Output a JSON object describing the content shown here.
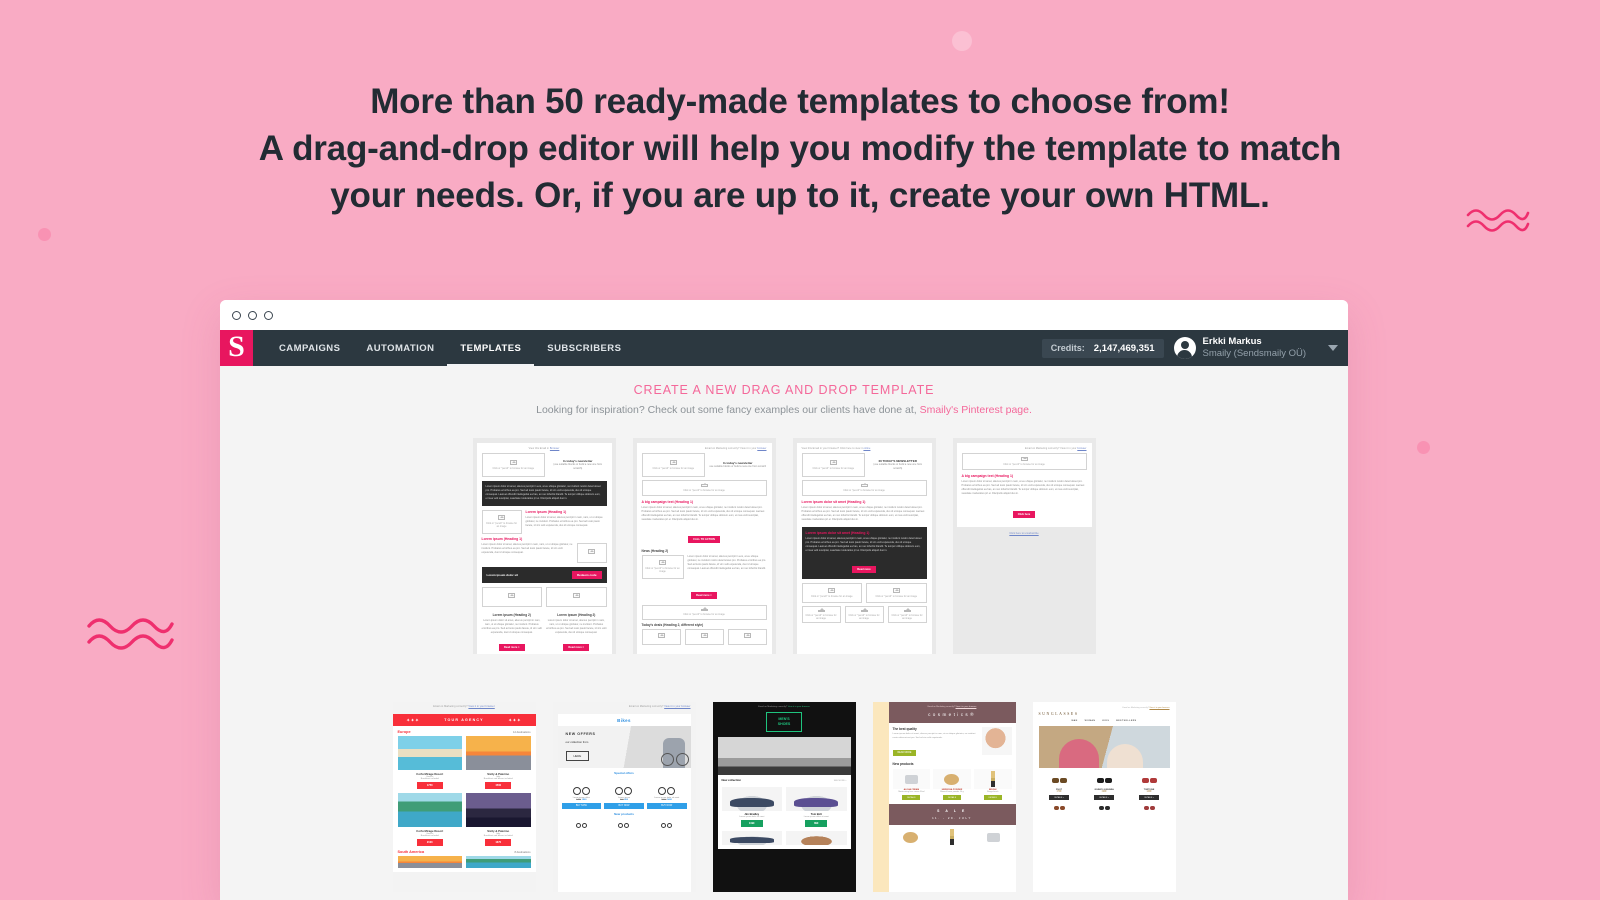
{
  "headline": {
    "lines": [
      "More than 50 ready-made templates to choose from!",
      "A drag-and-drop editor will help you modify the template to match",
      "your needs. Or, if you are up to it, create your own HTML."
    ]
  },
  "colors": {
    "background": "#f9abc4",
    "accent_pink": "#e8165f",
    "link_pink": "#f4689a",
    "navbar": "#2c3840",
    "page_bg": "#f4f4f4"
  },
  "window": {
    "titlebar_dots": [
      "dot-1",
      "dot-2",
      "dot-3"
    ]
  },
  "nav": {
    "logo_letter": "S",
    "items": [
      {
        "label": "CAMPAIGNS",
        "active": false
      },
      {
        "label": "AUTOMATION",
        "active": false
      },
      {
        "label": "TEMPLATES",
        "active": true
      },
      {
        "label": "SUBSCRIBERS",
        "active": false
      }
    ],
    "credits_label": "Credits:",
    "credits_value": "2,147,469,351",
    "user_name": "Erkki Markus",
    "user_org": "Smaily (Sendsmaily OÜ)"
  },
  "page": {
    "create_title": "CREATE A NEW DRAG AND DROP TEMPLATE",
    "sub_prefix": "Looking for inspiration? Check out some fancy examples our clients have done at, ",
    "sub_link": "Smaily's Pinterest page.",
    "sub_suffix": ""
  },
  "templates_row1": [
    {
      "name": "basic-newsletter-template",
      "preheader": "View this Email in",
      "preheader_link": "Browser",
      "image_box_text": "Click or \"pencil\" to browse for an image",
      "intro_title": "In today's newsletter",
      "intro_sub": "(use suitable blocks or build a new one from scratch)",
      "dark_text": "Lorem ipsum dolor sit amet, alienus percipit in eos, at eu ubique gloriatur, ne invidunt nostro deterruisset pro. Probatus erroribus ea pro. Sed ad iusto paulo facete, id vim velit expetenda, duo id utroque consequat. Laoreet offendit intellegebat ea has, an nec lobortis blandit. Te tempor oblique dolorem eum, ei mea velit suscipiat, suavitate moderatius pri ei. Discipulis aliquid duo in.",
      "heading_right": "Lorem ipsum (Heading 1)",
      "heading_left": "Lorem ipsum (Heading 1)",
      "body_text": "Lorem ipsum dolor sit amet, alienus percipit in nam, nam, ut ut ubique gloriatur, ne invidunt. Probatus erroribus ea pro. Sed ad iusto paulo facete, id vim velit expetenda, duo id utroque consequat.",
      "bar_text": "Lorem ipsum dolor sit",
      "bar_button": "Redeem code",
      "card_heading_a": "Lorem ipsum (Heading 2)",
      "card_heading_b": "Lorem ipsum (Heading 2)",
      "card_button": "Read more >"
    },
    {
      "name": "campaign-newsletter-template",
      "preheader": "Email on Marketing correctly? View it in your",
      "preheader_link": "browser",
      "intro_title": "In today's newsletter",
      "intro_sub": "use suitable blocks or build a new one from scratch",
      "heading": "A big campaign text (Heading 1)",
      "body_text": "Lorem ipsum dolor sit amet, alienus percipit in nam, at eu ubique gloriatur, ne invidunt nostro deterruisset pro. Probatus erroribus ea pro. Sed ad iusto paulo facete, id vim velit expetenda, duo id utroque consequat. Laoreet offendit intellegebat ea has, an nec lobortis blandit. Te tempor oblique dolorem eum, ei mea velit suscipiat, suavitate moderatius pri ei. Discipulis aliquid duo in.",
      "cta_button": "CALL TO ACTION",
      "news_heading": "News (Heading 2)",
      "news_text": "Lorem ipsum dolor sit amet, alienus percipit in eos, at eu ubique gloriatur, ne invidunt nostro deterruisset pro. Probatus erroribus ea pro. Sed ad iusto paulo facete, id vim velit expetenda, duo id utroque consequat. Laoreet offendit intellegebat ea has, an nec lobortis blandit.",
      "read_button": "Read more >",
      "deals_heading": "Today's deals (Heading 2, different style)"
    },
    {
      "name": "todays-newsletter-template",
      "preheader": "View this Email in your browser? Click here to view it",
      "preheader_link": "online",
      "intro_title": "IN TODAY'S NEWSLETTER",
      "intro_sub": "(use suitable blocks or build a new one from scratch)",
      "heading": "Lorem ipsum dolor sit amet (Heading 1)",
      "body_text": "Lorem ipsum dolor sit amet, alienus percipit in nam, at eu ubique gloriatur, ne invidunt nostro deterruisset pro. Probatus erroribus ea pro. Sed ad iusto paulo facete, id vim velit expetenda, duo id utroque consequat. Laoreet offendit intellegebat ea has, an nec lobortis blandit. Te tempor oblique dolorem eum, ei mea velit suscipiat, suavitate moderatius pri ei. Discipulis aliquid duo in.",
      "dark_heading": "Lorem ipsum dolor sit amet (Heading 1)",
      "cta_button": "Read more"
    },
    {
      "name": "simple-campaign-template",
      "preheader": "Email on Marketing correctly? View it in your",
      "preheader_link": "browser",
      "heading": "A big campaign text (Heading 1)",
      "body_text": "Lorem ipsum dolor sit amet, alienus percipit in nam, at eu ubique gloriatur, ne invidunt nostro deterruisset pro. Probatus erroribus ea pro. Sed ad iusto paulo facete, id vim velit expetenda, duo id utroque consequat. Laoreet offendit intellegebat ea has, an nec lobortis blandit. Te tempor oblique dolorem eum, ei mea velit suscipiat, suavitate moderatius pri ei. Discipulis aliquid duo in.",
      "cta_button": "Click here",
      "footer": "Click here to unsubscribe"
    }
  ],
  "templates_row2": [
    {
      "name": "tour-agency-template",
      "preheader": "Email on Marketing correctly?",
      "preheader_link": "View it in your browser",
      "brand": "TOUR AGENCY",
      "ornament": "✦✦✦",
      "section_title": "Europe",
      "section_meta": "12 destinations",
      "items": [
        {
          "title": "Corfu Mirage Resort",
          "country": "Greece",
          "note": "Breakfast included",
          "price": "1750"
        },
        {
          "title": "Sicily & Palermo",
          "country": "Italy",
          "note": "Breakfast and dinner included",
          "price": "1500"
        },
        {
          "title": "Corfu Mirage Resort",
          "country": "Greece",
          "note": "Breakfast included",
          "price": "2100"
        },
        {
          "title": "Sicily & Palermo",
          "country": "Italy",
          "note": "Breakfast and dinner included",
          "price": "1670"
        }
      ],
      "section_title2": "South America",
      "section_meta2": "8 destinations"
    },
    {
      "name": "bikes-template",
      "preheader": "Email on Marketing correctly?",
      "preheader_link": "View it in your browser",
      "brand": "Bikes",
      "hero_line1": "NEW OFFERS",
      "hero_line2": "our collection from",
      "hero_button": "HERE",
      "section_title": "Special offers",
      "items": [
        {
          "title": "Lorem ipsum dolor",
          "old": "1750",
          "new": "1500",
          "button": "BUY NOW"
        },
        {
          "title": "Lorem ipsum",
          "old": "900",
          "new": "800",
          "button": "BUY NOW"
        },
        {
          "title": "Lorem ipsum dolor sit amet",
          "old": "2600",
          "new": "1400",
          "button": "BUY NOW"
        }
      ],
      "section_title2": "New products"
    },
    {
      "name": "mens-shoes-template",
      "preheader": "Email on Marketing correctly?",
      "preheader_link": "View it in your browser",
      "brand_line1": "MEN'S",
      "brand_line2": "SHOES",
      "section_title": "New collection",
      "section_link": "SEE MORE >",
      "items": [
        {
          "title": "Jim Bradley",
          "desc": "Lorem ipsum dolor sit amet",
          "price": "119€"
        },
        {
          "title": "Tom Bolt",
          "desc": "Lorem ipsum dolor sit amet",
          "price": "89€"
        }
      ]
    },
    {
      "name": "cosmetics-template",
      "preheader": "Email on Marketing correctly?",
      "preheader_link": "View it in your browser",
      "brand": "cosmetics®",
      "intro_heading": "The best quality",
      "intro_text": "Lorem ipsum dolor sit amet, alienus percipit in nam, at eu ubique gloriatur, ne invidunt nostro deterruisset pro. Sed ad vim velit expetenda.",
      "intro_button": "READ MORE",
      "section_title": "New products",
      "items": [
        {
          "title": "ALOHA CREAM",
          "desc": "Moisturizing face cream 50ml",
          "button": "DETAILS"
        },
        {
          "title": "HERMOSA POWDER",
          "desc": "Mineral loose powder 10 g",
          "button": "DETAILS"
        },
        {
          "title": "BRUSH",
          "desc": "Rouge brush",
          "button": "DETAILS"
        }
      ],
      "sale_title": "S A L E",
      "sale_dates": "11. - 29. JULY"
    },
    {
      "name": "sunglasses-template",
      "preheader": "Email on Marketing correctly?",
      "preheader_link": "View it in your browser",
      "brand": "SUNGLASSES",
      "nav": [
        "MAN",
        "WOMAN",
        "KIDS",
        "BESTSELLERS"
      ],
      "items": [
        {
          "title": "PILOT",
          "price": "179€"
        },
        {
          "title": "JOHNNY GUEVARA",
          "price": "199€"
        },
        {
          "title": "TORTOISE",
          "price": "149€"
        }
      ],
      "button_label": "DETAILS >"
    }
  ]
}
